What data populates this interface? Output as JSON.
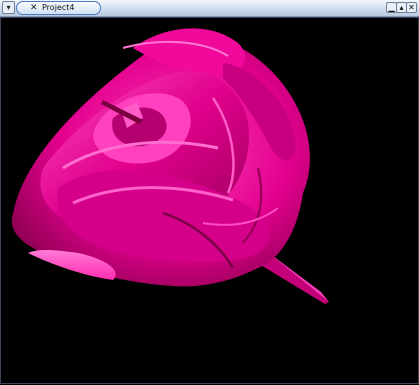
{
  "window": {
    "title": "Project4",
    "menu_icon": "menu-arrow-icon",
    "tab_icon": "x-app-icon",
    "controls": {
      "minimize_icon": "minimize-icon",
      "maximize_icon": "maximize-icon",
      "close_icon": "close-icon"
    }
  },
  "scene": {
    "subject": "pink rose",
    "colors": {
      "petal": "#ff1aa8",
      "petal_dark": "#a80062",
      "background": "#000000"
    }
  }
}
